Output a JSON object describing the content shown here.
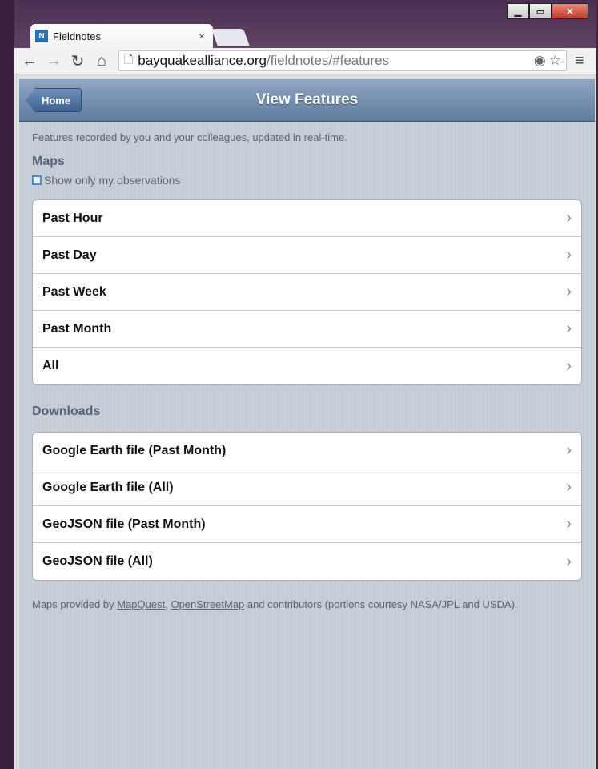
{
  "browser": {
    "tab_title": "Fieldnotes",
    "favicon_text": "N",
    "url_host": "bayquakealliance.org",
    "url_path": "/fieldnotes/#features"
  },
  "header": {
    "home_label": "Home",
    "title": "View Features"
  },
  "content": {
    "description": "Features recorded by you and your colleagues, updated in real-time.",
    "maps_heading": "Maps",
    "checkbox_label": "Show only my observations",
    "maps_items": [
      "Past Hour",
      "Past Day",
      "Past Week",
      "Past Month",
      "All"
    ],
    "downloads_heading": "Downloads",
    "downloads_items": [
      "Google Earth file (Past Month)",
      "Google Earth file (All)",
      "GeoJSON file (Past Month)",
      "GeoJSON file (All)"
    ],
    "footer": {
      "prefix": "Maps provided by ",
      "link1": "MapQuest",
      "sep": ", ",
      "link2": "OpenStreetMap",
      "suffix": " and contributors (portions courtesy NASA/JPL and USDA)."
    }
  },
  "colors": {
    "header_blue": "#5f7b9d",
    "content_bg": "#c7ced7",
    "heading_text": "#56647a"
  }
}
